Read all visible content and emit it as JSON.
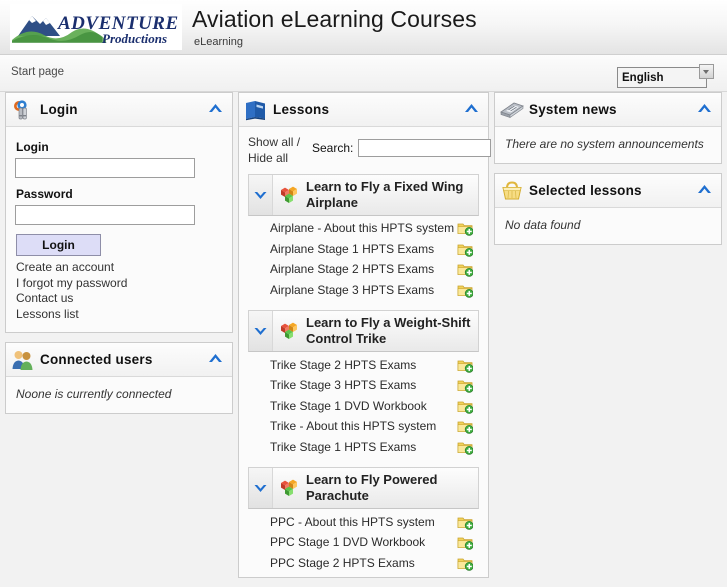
{
  "header": {
    "logo_alt": "Adventure Productions",
    "logo_word": "ADVENTURE",
    "logo_script": "Productions",
    "title": "Aviation eLearning Courses",
    "subtitle": "eLearning"
  },
  "navbar": {
    "breadcrumb": "Start page",
    "language_selected": "English",
    "language_options": [
      "English"
    ]
  },
  "login_panel": {
    "title": "Login",
    "icon": "keys-icon",
    "login_label": "Login",
    "login_value": "",
    "password_label": "Password",
    "password_value": "",
    "submit_label": "Login",
    "links": [
      "Create an account",
      "I forgot my password",
      "Contact us",
      "Lessons list"
    ]
  },
  "connected_panel": {
    "title": "Connected users",
    "icon": "users-icon",
    "empty_text": "Noone is currently connected"
  },
  "lessons_panel": {
    "title": "Lessons",
    "icon": "book-icon",
    "show_all_label": "Show all /",
    "hide_all_label": "Hide all",
    "search_label": "Search:",
    "search_value": "",
    "groups": [
      {
        "title": "Learn to Fly a Fixed Wing Airplane",
        "icon": "cubes-icon",
        "expanded": true,
        "lessons": [
          "Airplane - About this HPTS system",
          "Airplane Stage 1 HPTS Exams",
          "Airplane Stage 2 HPTS Exams",
          "Airplane Stage 3 HPTS Exams"
        ]
      },
      {
        "title": "Learn to Fly a Weight-Shift Control Trike",
        "icon": "cubes-icon",
        "expanded": true,
        "lessons": [
          "Trike Stage 2 HPTS Exams",
          "Trike Stage 3 HPTS Exams",
          "Trike Stage 1 DVD Workbook",
          "Trike - About this HPTS system",
          "Trike Stage 1 HPTS Exams"
        ]
      },
      {
        "title": "Learn to Fly Powered Parachute",
        "icon": "cubes-icon",
        "expanded": true,
        "lessons": [
          "PPC - About this HPTS system",
          "PPC Stage 1 DVD Workbook",
          "PPC Stage 2 HPTS Exams"
        ]
      }
    ],
    "lesson_action_icon": "add-to-folder-icon"
  },
  "system_news_panel": {
    "title": "System news",
    "icon": "news-icon",
    "empty_text": "There are no system announcements"
  },
  "selected_lessons_panel": {
    "title": "Selected lessons",
    "icon": "basket-icon",
    "empty_text": "No data found"
  },
  "colors": {
    "accent_blue": "#1f6fd0",
    "button_fill": "#ddddf7",
    "panel_border": "#cccccc",
    "page_bg": "#f2f2f2"
  }
}
